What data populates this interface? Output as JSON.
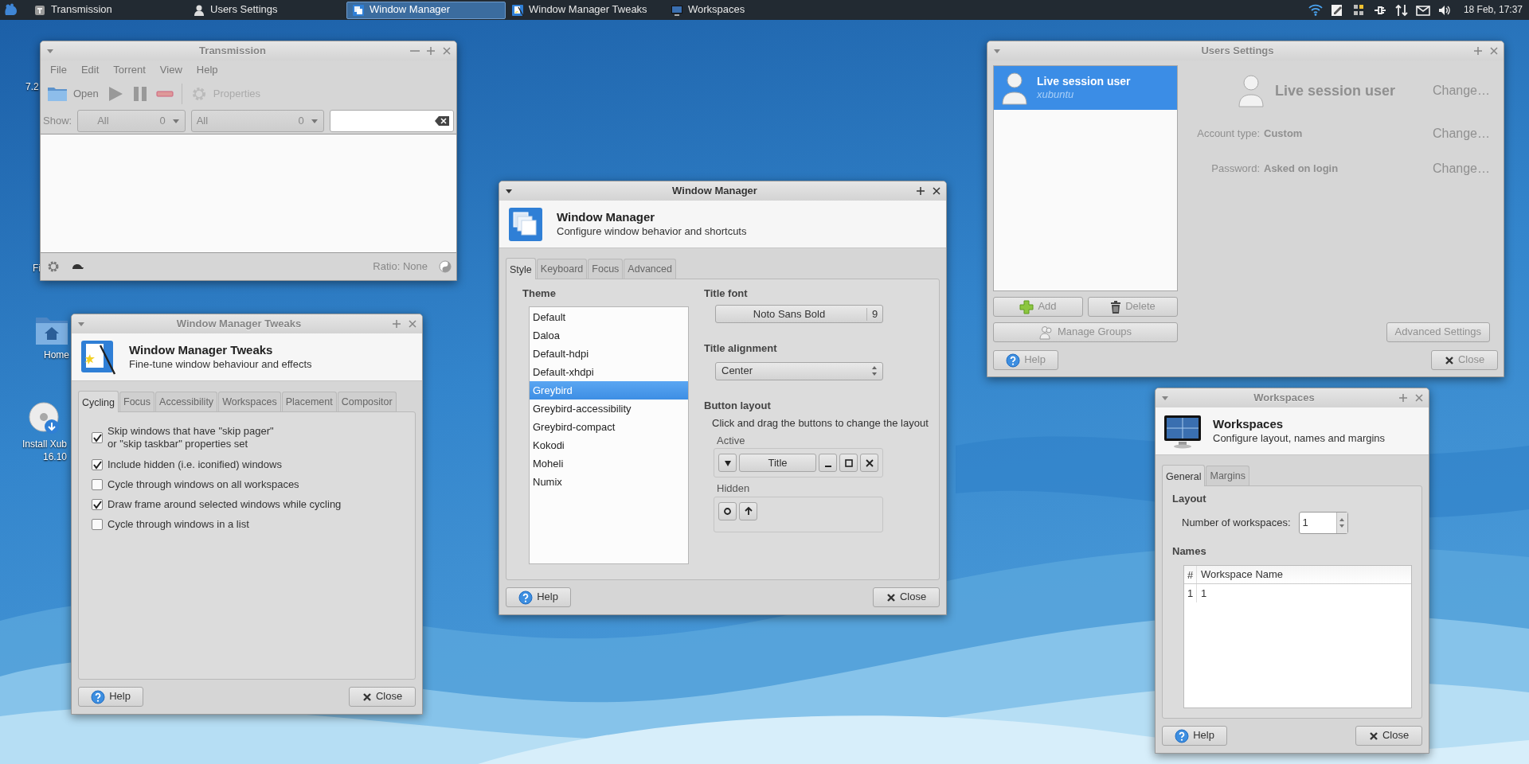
{
  "panel": {
    "tasks": [
      {
        "label": "Transmission",
        "kind": "torrent",
        "selected": false
      },
      {
        "label": "Users Settings",
        "kind": "users",
        "selected": false
      },
      {
        "label": "Window Manager",
        "kind": "windows",
        "selected": true
      },
      {
        "label": "Window Manager Tweaks",
        "kind": "tweaks",
        "selected": false
      },
      {
        "label": "Workspaces",
        "kind": "monitor",
        "selected": false
      }
    ],
    "clock": "18 Feb, 17:37"
  },
  "desktop": [
    {
      "lines": [
        "7.2"
      ]
    },
    {
      "lines": [
        "Fi"
      ]
    },
    {
      "lines": [
        "Home"
      ],
      "kind": "home"
    },
    {
      "lines": [
        "Install Xub",
        "16.10"
      ],
      "kind": "installer"
    }
  ],
  "transmission": {
    "title": "Transmission",
    "active": false,
    "menu": [
      "File",
      "Edit",
      "Torrent",
      "View",
      "Help"
    ],
    "toolbar": [
      {
        "kind": "open",
        "label": "Open",
        "disabled": false
      },
      {
        "kind": "start",
        "disabled": true
      },
      {
        "kind": "pause",
        "disabled": true
      },
      {
        "kind": "remove",
        "disabled": true
      },
      {
        "kind": "properties",
        "label": "Properties",
        "disabled": true
      }
    ],
    "show_label": "Show:",
    "filters": [
      {
        "value": "All",
        "count": "0"
      },
      {
        "value": "All",
        "count": "0"
      }
    ],
    "ratio": "Ratio: None"
  },
  "tweaks": {
    "title": "Window Manager Tweaks",
    "active": false,
    "heading": "Window Manager Tweaks",
    "subtitle": "Fine-tune window behaviour and effects",
    "tabs": [
      {
        "label": "Cycling",
        "selected": true
      },
      {
        "label": "Focus",
        "selected": false
      },
      {
        "label": "Accessibility",
        "selected": false
      },
      {
        "label": "Workspaces",
        "selected": false
      },
      {
        "label": "Placement",
        "selected": false
      },
      {
        "label": "Compositor",
        "selected": false
      }
    ],
    "options": [
      {
        "label": "Skip windows that have \"skip pager\"\nor \"skip taskbar\" properties set",
        "checked": true
      },
      {
        "label": "Include hidden (i.e. iconified) windows",
        "checked": true
      },
      {
        "label": "Cycle through windows on all workspaces",
        "checked": false
      },
      {
        "label": "Draw frame around selected windows while cycling",
        "checked": true
      },
      {
        "label": "Cycle through windows in a list",
        "checked": false
      }
    ],
    "help": "Help",
    "close": "Close"
  },
  "users_settings": {
    "title": "Users Settings",
    "active": false,
    "disabled": true,
    "users": [
      {
        "name": "Live session user",
        "login": "xubuntu",
        "selected": true
      }
    ],
    "name": "Live session user",
    "name_action": "Change…",
    "fields": [
      {
        "label": "Account type:",
        "value": "Custom",
        "action": "Change…"
      },
      {
        "label": "Password:",
        "value": "Asked on login",
        "action": "Change…"
      }
    ],
    "add": "Add",
    "delete": "Delete",
    "manage_groups": "Manage Groups",
    "advanced": "Advanced Settings",
    "help": "Help",
    "close": "Close"
  },
  "workspaces": {
    "title": "Workspaces",
    "active": false,
    "heading": "Workspaces",
    "subtitle": "Configure layout, names and margins",
    "tabs": [
      {
        "label": "General",
        "selected": true
      },
      {
        "label": "Margins",
        "selected": false
      }
    ],
    "layout_label": "Layout",
    "count_label": "Number of workspaces:",
    "count": "1",
    "names_label": "Names",
    "table": {
      "columns": [
        "#",
        "Workspace Name"
      ],
      "rows": [
        [
          "1",
          "1"
        ]
      ]
    },
    "help": "Help",
    "close": "Close"
  },
  "window_manager": {
    "title": "Window Manager",
    "active": true,
    "heading": "Window Manager",
    "subtitle": "Configure window behavior and shortcuts",
    "tabs": [
      {
        "label": "Style",
        "selected": true
      },
      {
        "label": "Keyboard",
        "selected": false
      },
      {
        "label": "Focus",
        "selected": false
      },
      {
        "label": "Advanced",
        "selected": false
      }
    ],
    "theme_label": "Theme",
    "themes": [
      {
        "name": "Default",
        "selected": false
      },
      {
        "name": "Daloa",
        "selected": false
      },
      {
        "name": "Default-hdpi",
        "selected": false
      },
      {
        "name": "Default-xhdpi",
        "selected": false
      },
      {
        "name": "Greybird",
        "selected": true
      },
      {
        "name": "Greybird-accessibility",
        "selected": false
      },
      {
        "name": "Greybird-compact",
        "selected": false
      },
      {
        "name": "Kokodi",
        "selected": false
      },
      {
        "name": "Moheli",
        "selected": false
      },
      {
        "name": "Numix",
        "selected": false
      }
    ],
    "title_font_label": "Title font",
    "font": "Noto Sans Bold",
    "font_size": "9",
    "alignment_label": "Title alignment",
    "alignment": "Center",
    "button_layout_label": "Button layout",
    "button_layout_hint": "Click and drag the buttons to change the layout",
    "active_label": "Active",
    "active_buttons": [
      {
        "kind": "menu"
      },
      {
        "kind": "title",
        "label": "Title"
      },
      {
        "kind": "minimize"
      },
      {
        "kind": "maximize"
      },
      {
        "kind": "close"
      }
    ],
    "hidden_label": "Hidden",
    "hidden_buttons": [
      {
        "kind": "stick"
      },
      {
        "kind": "shade"
      }
    ],
    "help": "Help",
    "close": "Close"
  }
}
